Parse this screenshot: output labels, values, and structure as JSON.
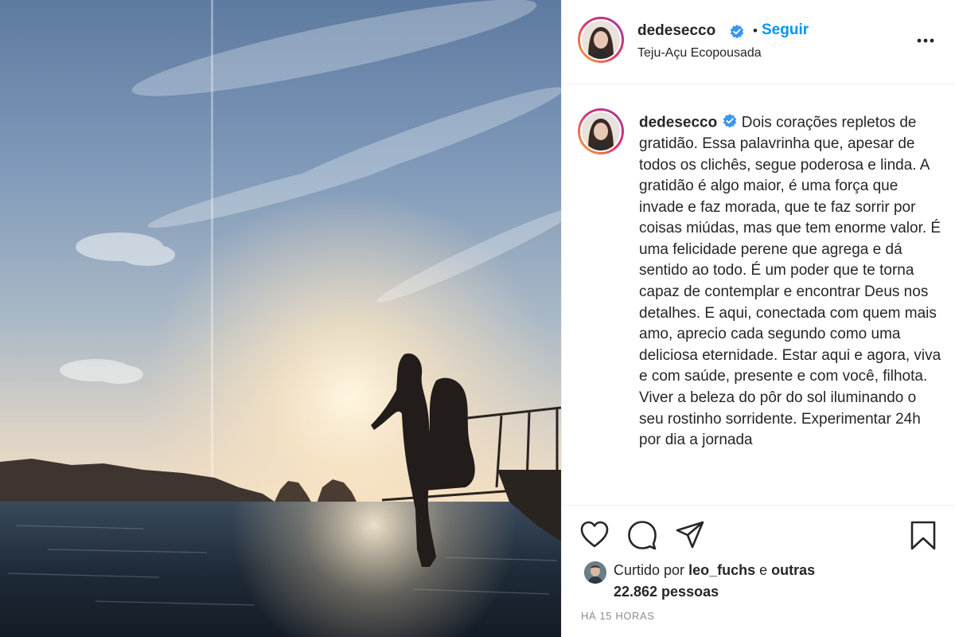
{
  "post": {
    "image_alt": "",
    "header": {
      "username": "dedesecco",
      "dot": "•",
      "follow_label": "Seguir",
      "location": "Teju-Açu Ecopousada"
    },
    "caption": {
      "username": "dedesecco",
      "text": "Dois corações repletos de gratidão. Essa palavrinha que, apesar de todos os clichês, segue poderosa e linda. A gratidão é algo maior, é uma força que invade e faz morada, que te faz sorrir por coisas miúdas, mas que tem enorme valor. É uma felicidade perene que agrega e dá sentido ao todo. É um poder que te torna capaz de contemplar e encontrar Deus nos detalhes. E aqui, conectada com quem mais amo, aprecio cada segundo como uma deliciosa eternidade. Estar aqui e agora, viva e com saúde, presente e com você, filhota. Viver a beleza do pôr do sol iluminando o seu rostinho sorridente. Experimentar 24h por dia a jornada"
    },
    "likes": {
      "prefix": "Curtido por",
      "liker": "leo_fuchs",
      "conjunction": "e",
      "others": "outras 22.862 pessoas"
    },
    "timestamp": "HÁ 15 HORAS"
  },
  "icons": {
    "verified": "verified-badge-icon",
    "more": "more-options-icon",
    "like": "heart-icon",
    "comment": "comment-icon",
    "share": "share-icon",
    "save": "bookmark-icon"
  },
  "colors": {
    "accent": "#0095f6",
    "verified": "#3897f0",
    "text": "#262626",
    "muted": "#8e8e8e",
    "divider": "#efefef"
  }
}
